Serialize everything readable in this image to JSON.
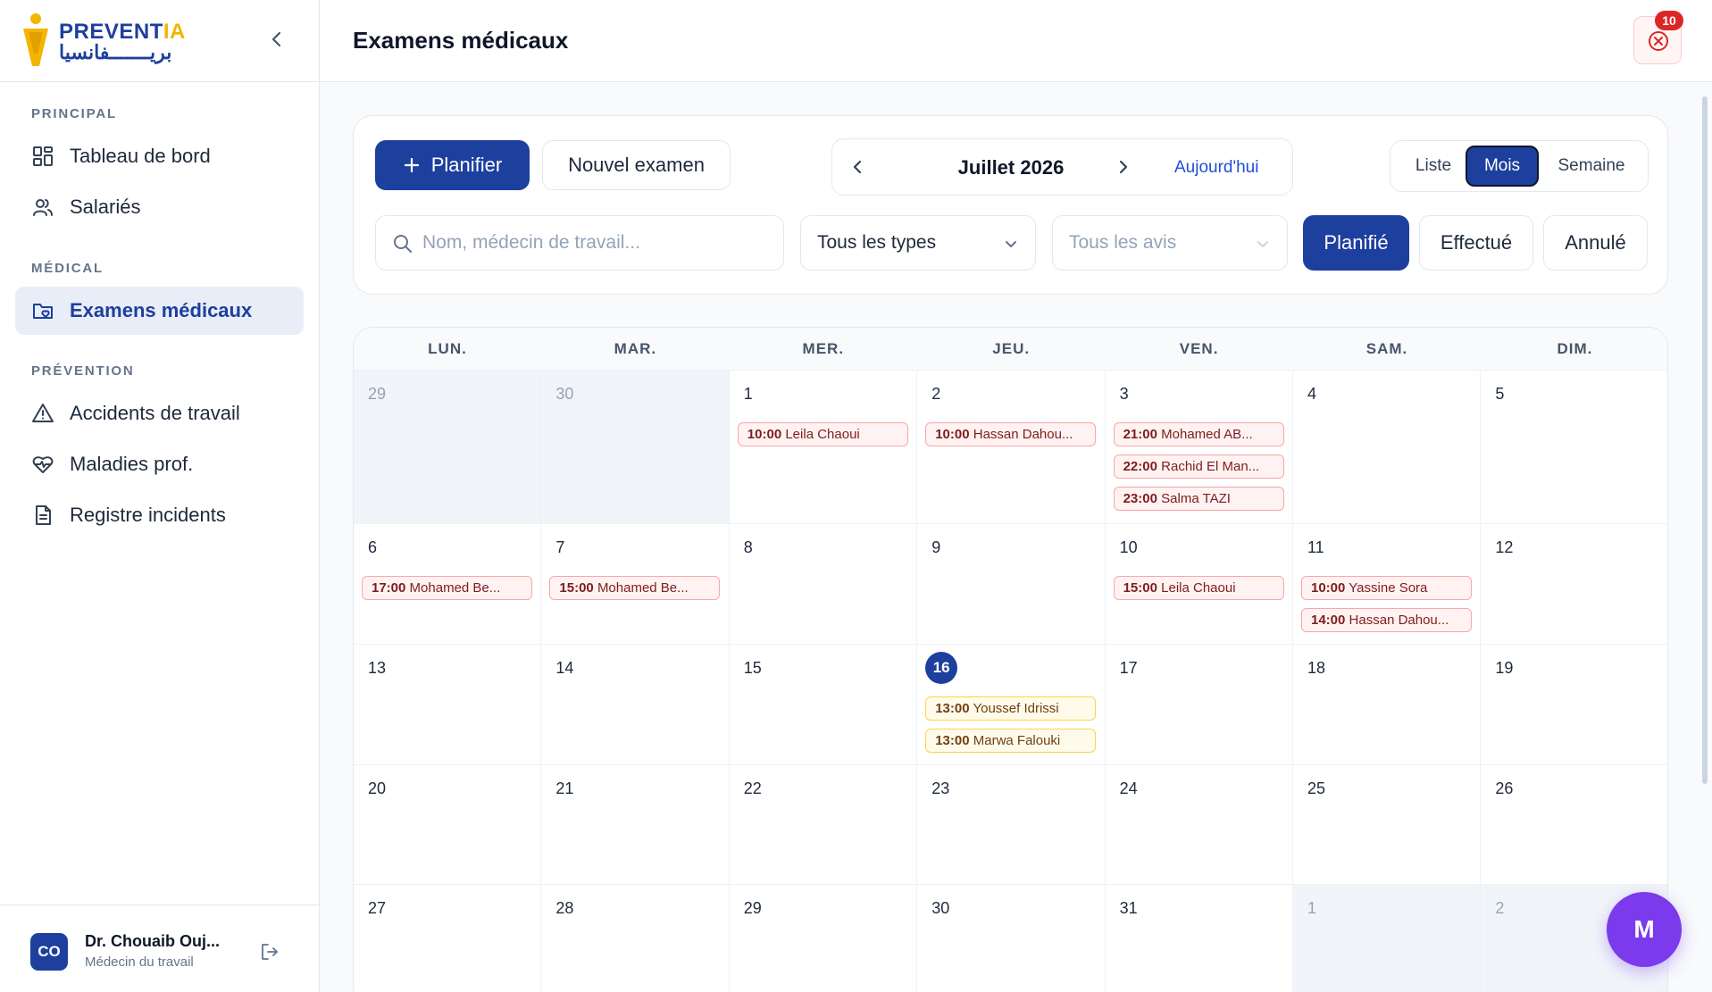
{
  "brand": {
    "name_part1": "PREVENT",
    "name_part2": "IA",
    "name_arabic": "بريـــــــفانسيا"
  },
  "sidebar": {
    "sections": [
      {
        "title": "PRINCIPAL",
        "items": [
          {
            "label": "Tableau de bord",
            "icon": "dashboard-icon"
          },
          {
            "label": "Salariés",
            "icon": "users-icon"
          }
        ]
      },
      {
        "title": "MÉDICAL",
        "items": [
          {
            "label": "Examens médicaux",
            "icon": "folder-heart-icon",
            "active": true
          }
        ]
      },
      {
        "title": "PRÉVENTION",
        "items": [
          {
            "label": "Accidents de travail",
            "icon": "warning-icon"
          },
          {
            "label": "Maladies prof.",
            "icon": "heart-pulse-icon"
          },
          {
            "label": "Registre incidents",
            "icon": "document-icon"
          }
        ]
      }
    ]
  },
  "user": {
    "initials": "CO",
    "name": "Dr. Chouaib Ouj...",
    "role": "Médecin du travail"
  },
  "header": {
    "title": "Examens médicaux",
    "notification_count": "10"
  },
  "toolbar": {
    "plan_label": "Planifier",
    "new_exam_label": "Nouvel examen",
    "month_label": "Juillet 2026",
    "today_label": "Aujourd'hui",
    "views": [
      "Liste",
      "Mois",
      "Semaine"
    ],
    "active_view": "Mois",
    "search_placeholder": "Nom, médecin de travail...",
    "type_filter": "Tous les types",
    "avis_filter": "Tous les avis",
    "status_filters": [
      "Planifié",
      "Effectué",
      "Annulé"
    ],
    "active_status": "Planifié"
  },
  "calendar": {
    "weekdays": [
      "LUN.",
      "MAR.",
      "MER.",
      "JEU.",
      "VEN.",
      "SAM.",
      "DIM."
    ],
    "weeks": [
      [
        {
          "day": "29",
          "out": true,
          "events": []
        },
        {
          "day": "30",
          "out": true,
          "events": []
        },
        {
          "day": "1",
          "events": [
            {
              "time": "10:00",
              "name": "Leila Chaoui"
            }
          ]
        },
        {
          "day": "2",
          "events": [
            {
              "time": "10:00",
              "name": "Hassan Dahou..."
            }
          ]
        },
        {
          "day": "3",
          "events": [
            {
              "time": "21:00",
              "name": "Mohamed AB..."
            },
            {
              "time": "22:00",
              "name": "Rachid El Man..."
            },
            {
              "time": "23:00",
              "name": "Salma TAZI"
            }
          ]
        },
        {
          "day": "4",
          "events": []
        },
        {
          "day": "5",
          "events": []
        }
      ],
      [
        {
          "day": "6",
          "events": [
            {
              "time": "17:00",
              "name": "Mohamed Be..."
            }
          ]
        },
        {
          "day": "7",
          "events": [
            {
              "time": "15:00",
              "name": "Mohamed Be..."
            }
          ]
        },
        {
          "day": "8",
          "events": []
        },
        {
          "day": "9",
          "events": []
        },
        {
          "day": "10",
          "events": [
            {
              "time": "15:00",
              "name": "Leila Chaoui"
            }
          ]
        },
        {
          "day": "11",
          "events": [
            {
              "time": "10:00",
              "name": "Yassine Sora"
            },
            {
              "time": "14:00",
              "name": "Hassan Dahou..."
            }
          ]
        },
        {
          "day": "12",
          "events": []
        }
      ],
      [
        {
          "day": "13",
          "events": []
        },
        {
          "day": "14",
          "events": []
        },
        {
          "day": "15",
          "events": []
        },
        {
          "day": "16",
          "today": true,
          "events": [
            {
              "time": "13:00",
              "name": "Youssef Idrissi",
              "tone": "amber"
            },
            {
              "time": "13:00",
              "name": "Marwa Falouki",
              "tone": "amber"
            }
          ]
        },
        {
          "day": "17",
          "events": []
        },
        {
          "day": "18",
          "events": []
        },
        {
          "day": "19",
          "events": []
        }
      ],
      [
        {
          "day": "20",
          "events": []
        },
        {
          "day": "21",
          "events": []
        },
        {
          "day": "22",
          "events": []
        },
        {
          "day": "23",
          "events": []
        },
        {
          "day": "24",
          "events": []
        },
        {
          "day": "25",
          "events": []
        },
        {
          "day": "26",
          "events": []
        }
      ],
      [
        {
          "day": "27",
          "events": []
        },
        {
          "day": "28",
          "events": []
        },
        {
          "day": "29",
          "events": []
        },
        {
          "day": "30",
          "events": []
        },
        {
          "day": "31",
          "events": []
        },
        {
          "day": "1",
          "out": true,
          "events": []
        },
        {
          "day": "2",
          "out": true,
          "events": []
        }
      ]
    ]
  },
  "fab": {
    "label": "M"
  },
  "colors": {
    "primary": "#1d3f9e",
    "accent": "#f4b400",
    "fab": "#7c3aed",
    "danger": "#dc2626"
  }
}
